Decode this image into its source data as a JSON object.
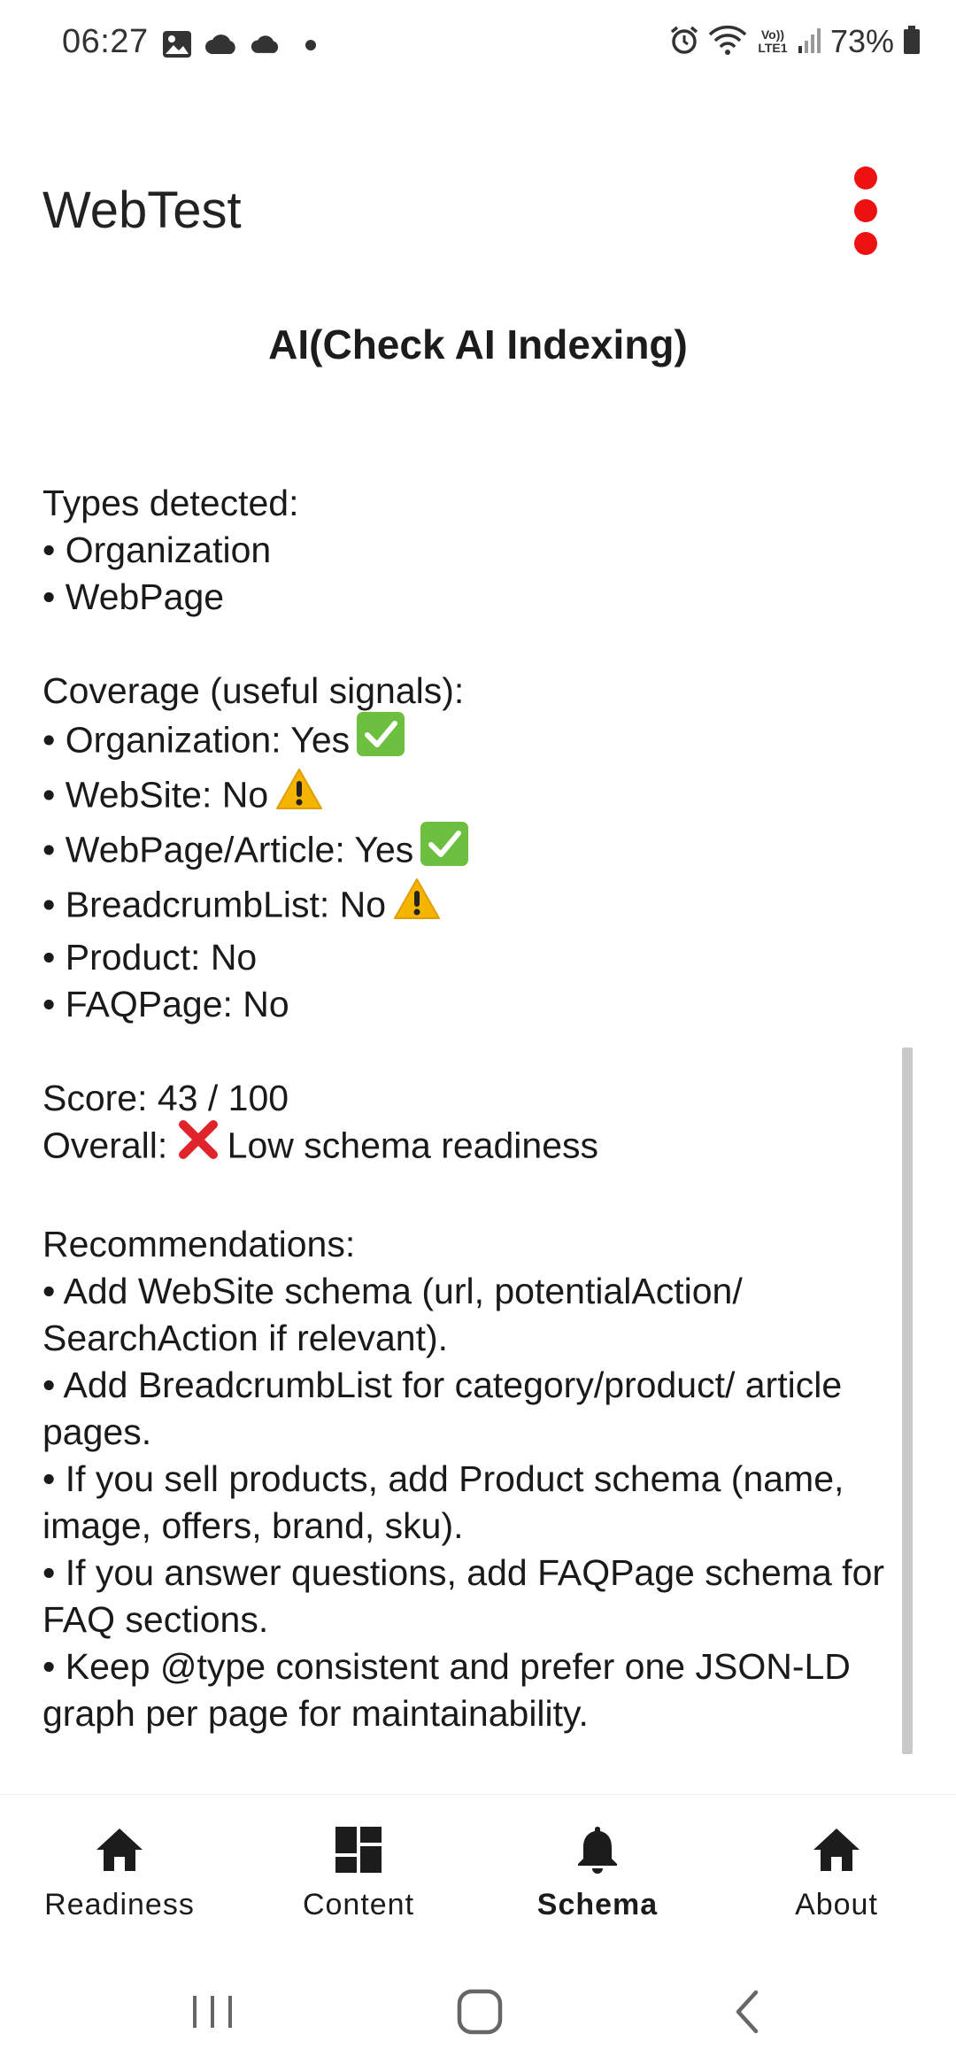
{
  "status_bar": {
    "time": "06:27",
    "battery": "73%",
    "left_icons": [
      "image-icon",
      "cloud-icon",
      "cloud-icon",
      "dot-icon"
    ],
    "right_icons": [
      "alarm-icon",
      "wifi-icon",
      "volte-icon",
      "signal-icon",
      "battery-icon"
    ],
    "volte_label": "Vo)) LTE1"
  },
  "app_bar": {
    "title": "WebTest",
    "menu_color": "#ee1111"
  },
  "page": {
    "heading": "AI(Check AI Indexing)"
  },
  "report": {
    "types_header": "Types detected:",
    "types": [
      "• Organization",
      "• WebPage"
    ],
    "coverage_header": "Coverage (useful signals):",
    "coverage": [
      {
        "text": "• Organization: Yes",
        "status": "check"
      },
      {
        "text": "• WebSite: No",
        "status": "warning"
      },
      {
        "text": "• WebPage/Article: Yes",
        "status": "check"
      },
      {
        "text": "• BreadcrumbList: No",
        "status": "warning"
      },
      {
        "text": "• Product: No",
        "status": "none"
      },
      {
        "text": "• FAQPage: No",
        "status": "none"
      }
    ],
    "score": "Score: 43 / 100",
    "overall_prefix": "Overall:",
    "overall_text": "Low schema readiness",
    "recommendations_header": "Recommendations:",
    "recommendations": [
      "• Add WebSite schema (url, potentialAction/ SearchAction if relevant).",
      "• Add BreadcrumbList for category/product/ article pages.",
      "• If you sell products, add Product schema (name, image, offers, brand, sku).",
      "• If you answer questions, add FAQPage schema for FAQ sections.",
      "• Keep @type consistent and prefer one JSON-LD graph per page for maintainability."
    ]
  },
  "bottom_nav": {
    "items": [
      {
        "label": "Readiness",
        "icon": "home-icon",
        "active": false
      },
      {
        "label": "Content",
        "icon": "dashboard-icon",
        "active": false
      },
      {
        "label": "Schema",
        "icon": "bell-icon",
        "active": true
      },
      {
        "label": "About",
        "icon": "home-icon",
        "active": false
      }
    ]
  },
  "system_nav": [
    "recents-icon",
    "home-circle-icon",
    "back-icon"
  ]
}
